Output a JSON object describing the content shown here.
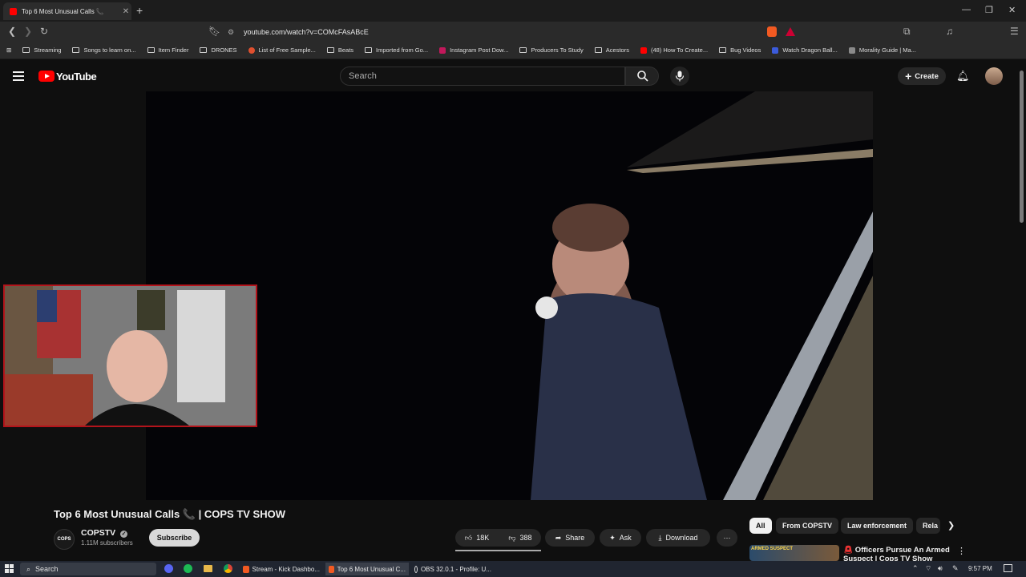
{
  "browser": {
    "tab_title": "Top 6 Most Unusual Calls 📞",
    "url": "youtube.com/watch?v=COMcFAsABcE",
    "bookmarks": [
      "Streaming",
      "Songs to learn on...",
      "Item Finder",
      "DRONES",
      "List of Free Sample...",
      "Beats",
      "Imported from Go...",
      "Instagram Post Dow...",
      "Producers To Study",
      "Acestors",
      "(48) How To Create...",
      "Bug Videos",
      "Watch Dragon Ball...",
      "Morality Guide | Ma..."
    ]
  },
  "youtube": {
    "logo_text": "YouTube",
    "search_placeholder": "Search",
    "create_label": "Create"
  },
  "video": {
    "title": "Top 6 Most Unusual Calls 📞 | COPS TV SHOW",
    "channel_name": "COPSTV",
    "channel_avatar_text": "COPS",
    "subscribers": "1.11M subscribers",
    "subscribe_label": "Subscribe",
    "likes": "18K",
    "dislikes": "388",
    "share_label": "Share",
    "ask_label": "Ask",
    "download_label": "Download"
  },
  "chips": [
    "All",
    "From COPSTV",
    "Law enforcement",
    "Rela"
  ],
  "recommendation": {
    "badge": "ARMED SUSPECT",
    "title": "Officers Pursue An Armed Suspect | Cops TV Show"
  },
  "taskbar": {
    "search_label": "Search",
    "apps": [
      "Stream - Kick Dashbo...",
      "Top 6 Most Unusual C...",
      "OBS 32.0.1 - Profile: U..."
    ],
    "time": "9:57 PM"
  },
  "colors": {
    "accent_red": "#ff0000",
    "bg": "#0f0f0f",
    "webcam_border": "#b3141b"
  }
}
